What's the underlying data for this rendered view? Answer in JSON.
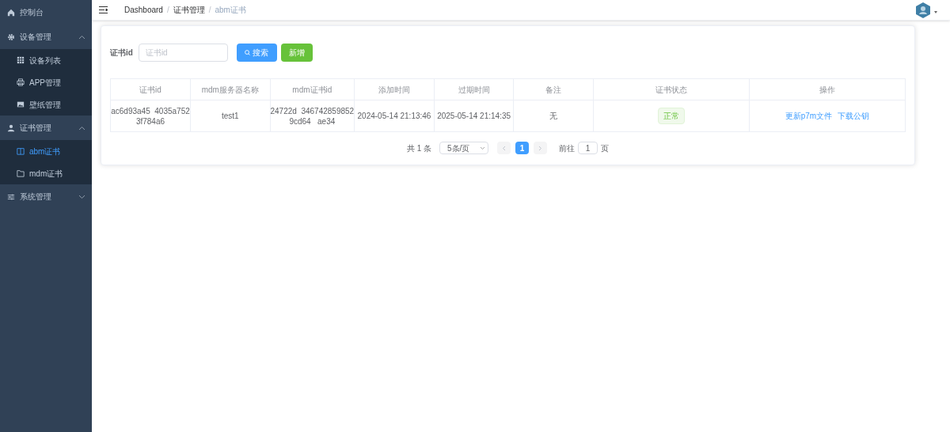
{
  "sidebar": {
    "items": [
      {
        "label": "控制台",
        "selected": false
      },
      {
        "label": "设备管理",
        "expanded": true,
        "children": [
          {
            "label": "设备列表",
            "selected": false
          },
          {
            "label": "APP管理",
            "selected": false
          },
          {
            "label": "壁纸管理",
            "selected": false
          }
        ]
      },
      {
        "label": "证书管理",
        "expanded": true,
        "children": [
          {
            "label": "abm证书",
            "selected": true
          },
          {
            "label": "mdm证书",
            "selected": false
          }
        ]
      },
      {
        "label": "系统管理",
        "expanded": false
      }
    ]
  },
  "breadcrumb": {
    "items": [
      "Dashboard",
      "证书管理",
      "abm证书"
    ],
    "separator": "/"
  },
  "search": {
    "label": "证书id",
    "placeholder": "证书id",
    "buttons": [
      {
        "label": "搜索",
        "kind": "search"
      },
      {
        "label": "新增",
        "kind": "add"
      }
    ]
  },
  "table": {
    "columns": [
      "证书id",
      "mdm服务器名称",
      "mdm证书id",
      "添加时间",
      "过期时间",
      "备注",
      "证书状态",
      "操作"
    ],
    "rows": [
      {
        "cert_id": [
          "ac6d93a45  4035a752",
          "3f784a6"
        ],
        "server_name": "test1",
        "mdm_cert_id": [
          "24722d  346742859852",
          "9cd64   ae34"
        ],
        "added": "2024-05-14 21:13:46",
        "expires": "2025-05-14 21:14:35",
        "note": "无",
        "status": "正常",
        "actions": [
          "更新p7m文件",
          "下载公钥"
        ]
      }
    ]
  },
  "pagination": {
    "total": "共 1 条",
    "page_size": "5条/页",
    "pages": [
      {
        "label": "1",
        "selected": true
      }
    ],
    "goto_label": "前往",
    "goto_value": "1",
    "goto_suffix": "页"
  }
}
